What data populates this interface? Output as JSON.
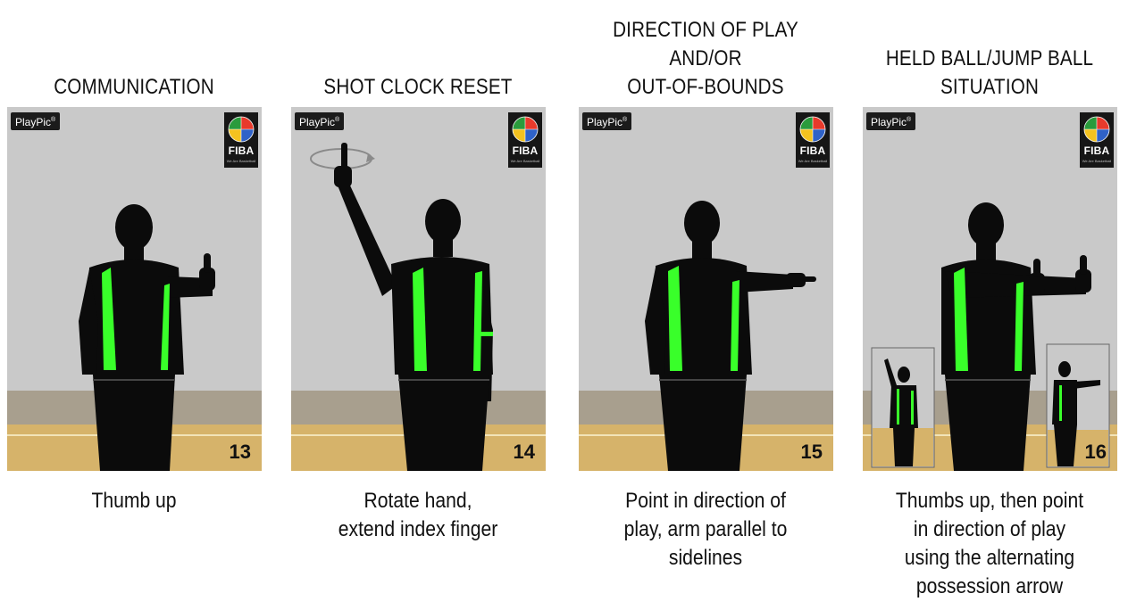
{
  "signals": [
    {
      "title_lines": [
        "COMMUNICATION"
      ],
      "description_lines": [
        "Thumb up"
      ],
      "number": "13",
      "brand": "PlayPic",
      "logo_text": "FIBA",
      "logo_tagline": "We Are Basketball"
    },
    {
      "title_lines": [
        "SHOT CLOCK RESET"
      ],
      "description_lines": [
        "Rotate hand,",
        "extend index finger"
      ],
      "number": "14",
      "brand": "PlayPic",
      "logo_text": "FIBA",
      "logo_tagline": "We Are Basketball"
    },
    {
      "title_lines": [
        "DIRECTION OF PLAY",
        "AND/OR",
        "OUT-OF-BOUNDS"
      ],
      "description_lines": [
        "Point in direction of",
        "play, arm parallel to",
        "sidelines"
      ],
      "number": "15",
      "brand": "PlayPic",
      "logo_text": "FIBA",
      "logo_tagline": "We Are Basketball"
    },
    {
      "title_lines": [
        "HELD BALL/JUMP BALL",
        "SITUATION"
      ],
      "description_lines": [
        "Thumbs up, then point",
        "in direction of play",
        "using the alternating",
        "possession arrow"
      ],
      "number": "16",
      "brand": "PlayPic",
      "logo_text": "FIBA",
      "logo_tagline": "We Are Basketball"
    }
  ],
  "colors": {
    "wall": "#c9c9c9",
    "floor": "#d6b36a",
    "baseboard": "#a89f8e",
    "jersey_accent": "#39ff2a",
    "silhouette": "#0b0b0b"
  },
  "icons": [
    "fiba-globe-icon",
    "rotation-arrow-icon"
  ]
}
